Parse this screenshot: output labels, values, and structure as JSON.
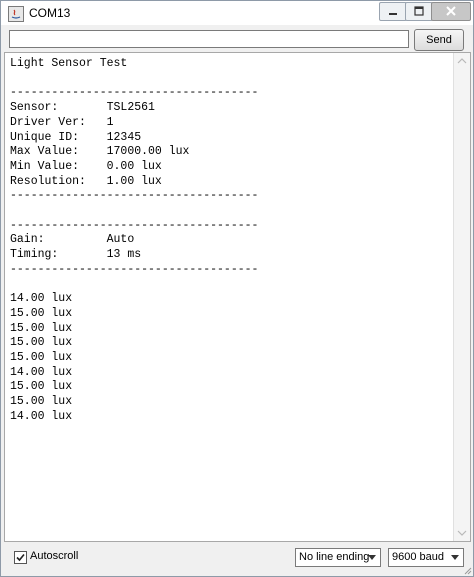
{
  "window": {
    "title": "COM13"
  },
  "toolbar": {
    "input_value": "",
    "send_label": "Send"
  },
  "serial_output": {
    "lines": [
      "Light Sensor Test",
      "",
      "------------------------------------",
      "Sensor:       TSL2561",
      "Driver Ver:   1",
      "Unique ID:    12345",
      "Max Value:    17000.00 lux",
      "Min Value:    0.00 lux",
      "Resolution:   1.00 lux",
      "------------------------------------",
      "",
      "------------------------------------",
      "Gain:         Auto",
      "Timing:       13 ms",
      "------------------------------------",
      "",
      "14.00 lux",
      "15.00 lux",
      "15.00 lux",
      "15.00 lux",
      "15.00 lux",
      "14.00 lux",
      "15.00 lux",
      "15.00 lux",
      "14.00 lux"
    ]
  },
  "footer": {
    "autoscroll_label": "Autoscroll",
    "autoscroll_checked": true,
    "line_ending": "No line ending",
    "baud_rate": "9600 baud"
  }
}
